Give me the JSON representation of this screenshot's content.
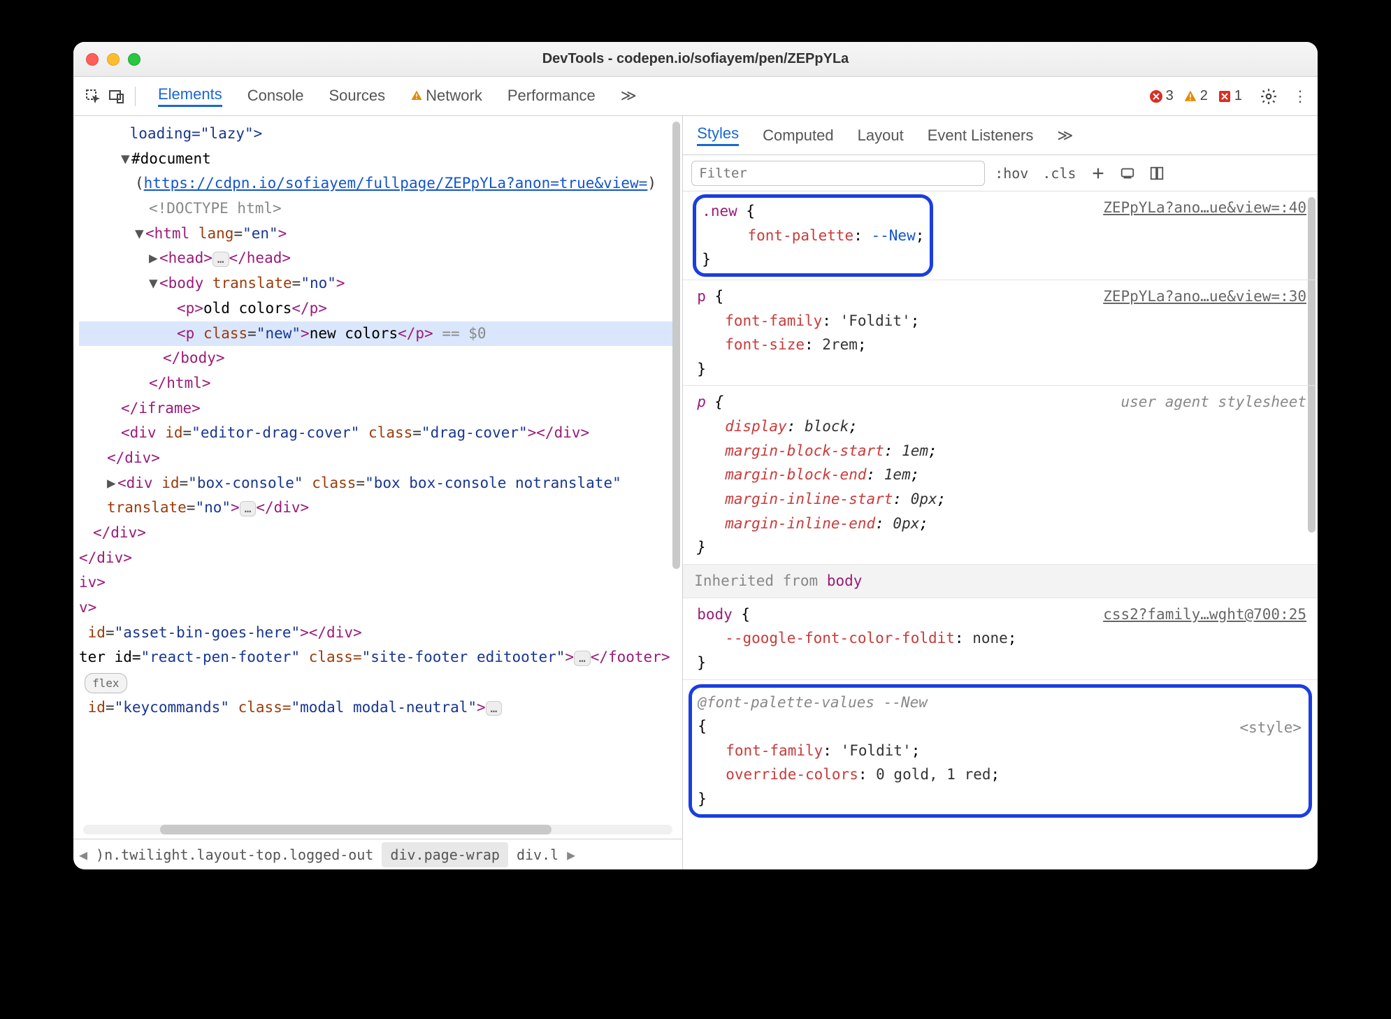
{
  "window": {
    "title": "DevTools - codepen.io/sofiayem/pen/ZEPpYLa"
  },
  "toolbar": {
    "tabs": [
      "Elements",
      "Console",
      "Sources",
      "Network",
      "Performance"
    ],
    "more": "≫",
    "activeTab": 0,
    "networkWarning": true,
    "counts": {
      "errors": "3",
      "warnings": "2",
      "crashes": "1"
    }
  },
  "dom": {
    "l1": " loading=\"lazy\">",
    "l2": "#document",
    "l3a": "(",
    "l3link": "https://cdpn.io/sofiayem/fullpage/ZEPpYLa?anon=true&view=",
    "l3b": ")",
    "l4": "<!DOCTYPE html>",
    "l5": {
      "open": "<html ",
      "a": "lang",
      "v": "\"en\"",
      "close": ">"
    },
    "l6": {
      "open": "<head>",
      "ell": "…",
      "close": "</head>"
    },
    "l7": {
      "open": "<body ",
      "a": "translate",
      "v": "\"no\"",
      "close": ">"
    },
    "l8": {
      "open": "<p>",
      "txt": "old colors",
      "close": "</p>"
    },
    "l9": {
      "open": "<p ",
      "a": "class",
      "v": "\"new\"",
      "mid": ">",
      "txt": "new colors",
      "close": "</p>",
      "eq": " == $0"
    },
    "l10": "</body>",
    "l11": "</html>",
    "l12": "</iframe>",
    "l13": {
      "open": "<div ",
      "a1": "id",
      "v1": "\"editor-drag-cover\"",
      "a2": "class",
      "v2": "\"drag-cover\"",
      "close": "></div>"
    },
    "l14": "</div>",
    "l15": {
      "open": "<div ",
      "a1": "id",
      "v1": "\"box-console\"",
      "a2": "class",
      "v2": "\"box box-console notranslate\"",
      "a3": "translate",
      "v3": "\"no\"",
      "close": ">",
      "ell": "…",
      "end": "</div>"
    },
    "l16": "</div>",
    "l17": "</div>",
    "l18": "iv>",
    "l19": "v>",
    "l20": {
      "pre": " id=",
      "v": "\"asset-bin-goes-here\"",
      "post": "></div>"
    },
    "l21": {
      "pre": "ter id=",
      "v1": "\"react-pen-footer\"",
      "mid": " class=",
      "v2": "\"site-footer editooter\"",
      "post": ">",
      "ell": "…",
      "end": "</footer>",
      "badge": "flex"
    },
    "l22": {
      "pre": " id=",
      "v1": "\"keycommands\"",
      "mid": " class=",
      "v2": "\"modal modal-neutral\"",
      "post": ">",
      "ell": "…"
    }
  },
  "breadcrumb": {
    "items": [
      ")n.twilight.layout-top.logged-out",
      "div.page-wrap",
      "div.l"
    ],
    "selectedIndex": 1
  },
  "rightTabs": {
    "items": [
      "Styles",
      "Computed",
      "Layout",
      "Event Listeners"
    ],
    "more": "≫",
    "activeTab": 0
  },
  "filter": {
    "placeholder": "Filter",
    "hov": ":hov",
    "cls": ".cls"
  },
  "styles": {
    "rule1": {
      "selector": ".new",
      "src": "ZEPpYLa?ano…ue&view=:40",
      "props": [
        {
          "p": "font-palette",
          "v": "--New"
        }
      ]
    },
    "rule2": {
      "selector": "p",
      "src": "ZEPpYLa?ano…ue&view=:30",
      "props": [
        {
          "p": "font-family",
          "v": "'Foldit'"
        },
        {
          "p": "font-size",
          "v": "2rem"
        }
      ]
    },
    "rule3": {
      "selector": "p",
      "src": "user agent stylesheet",
      "props": [
        {
          "p": "display",
          "v": "block"
        },
        {
          "p": "margin-block-start",
          "v": "1em"
        },
        {
          "p": "margin-block-end",
          "v": "1em"
        },
        {
          "p": "margin-inline-start",
          "v": "0px"
        },
        {
          "p": "margin-inline-end",
          "v": "0px"
        }
      ]
    },
    "inherited": {
      "label": "Inherited from",
      "from": "body"
    },
    "rule4": {
      "selector": "body",
      "src": "css2?family…wght@700:25",
      "props": [
        {
          "p": "--google-font-color-foldit",
          "v": "none"
        }
      ]
    },
    "rule5": {
      "atRule": "@font-palette-values --New",
      "src": "<style>",
      "props": [
        {
          "p": "font-family",
          "v": "'Foldit'"
        },
        {
          "p": "override-colors",
          "v": "0 gold, 1 red"
        }
      ]
    }
  }
}
